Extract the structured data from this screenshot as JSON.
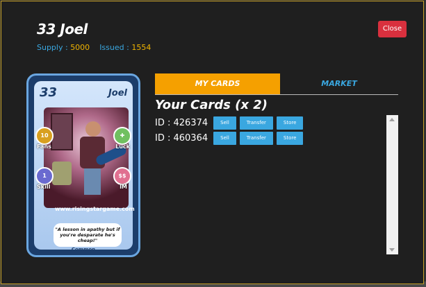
{
  "card_title": "33 Joel",
  "meta": {
    "supply_label": "Supply :",
    "supply_value": "5000",
    "issued_label": "Issued :",
    "issued_value": "1554"
  },
  "close_label": "Close",
  "card": {
    "number": "33",
    "name": "Joel",
    "stats": {
      "fans": "Fans",
      "luck": "Luck",
      "skill": "Skill",
      "im": "IM"
    },
    "url": "www.risingstargame.com",
    "quote": "\"A lesson in apathy but if you're desparate he's cheap!\"",
    "rarity": "Common"
  },
  "tabs": {
    "my_cards": "MY CARDS",
    "market": "MARKET"
  },
  "section_title": "Your Cards (x 2)",
  "cards_list": [
    {
      "id": "ID : 426374",
      "sell": "Sell",
      "transfer": "Transfer",
      "store": "Store"
    },
    {
      "id": "ID : 460364",
      "sell": "Sell",
      "transfer": "Transfer",
      "store": "Store"
    }
  ],
  "colors": {
    "accent": "#f5a000",
    "primary": "#3aa7e0",
    "danger": "#d9303e",
    "background": "#1f1f1f"
  }
}
